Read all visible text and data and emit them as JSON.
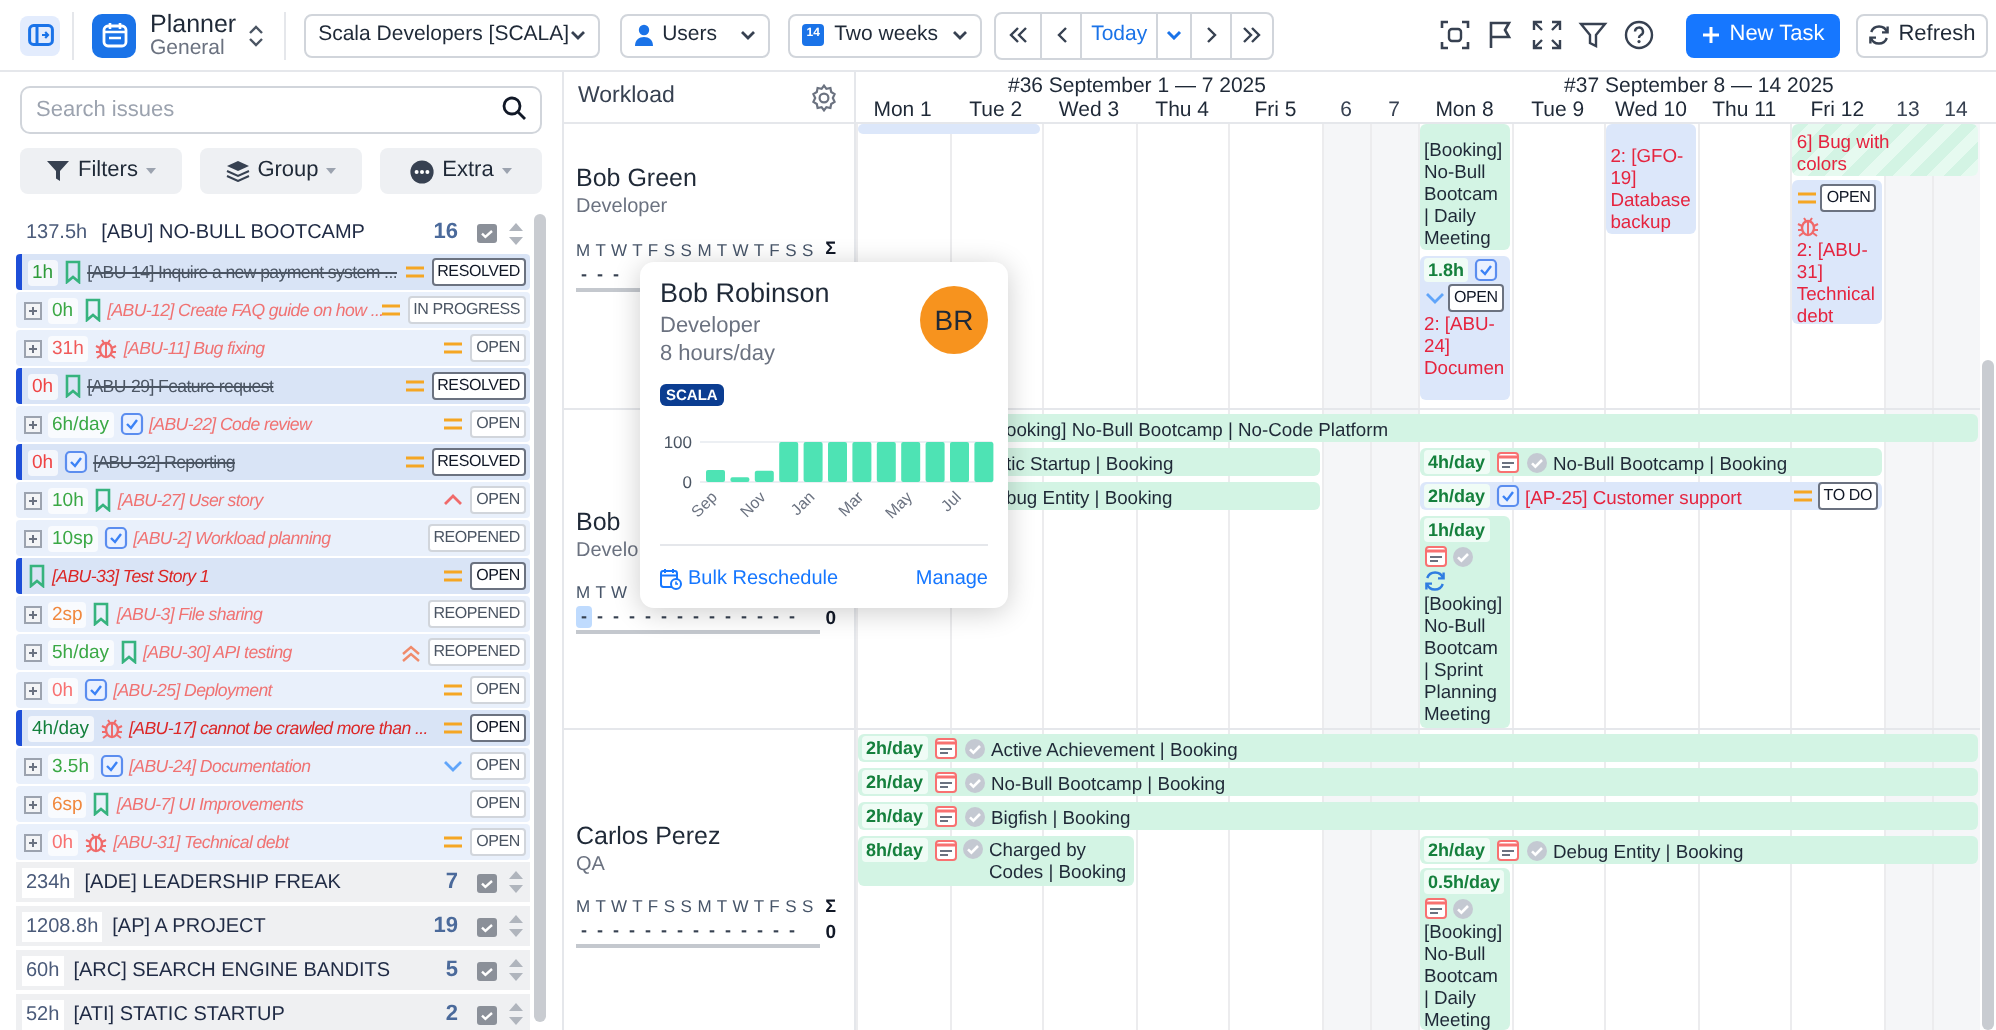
{
  "app": {
    "title": "Planner",
    "subtitle": "General"
  },
  "toolbar": {
    "team": "Scala Developers [SCALA]",
    "view": "Users",
    "range": "Two weeks",
    "range_icon": "14",
    "today": "Today",
    "new_task": "New Task",
    "refresh": "Refresh"
  },
  "search": {
    "placeholder": "Search issues"
  },
  "filters": [
    {
      "label": "Filters"
    },
    {
      "label": "Group"
    },
    {
      "label": "Extra"
    }
  ],
  "groups": [
    {
      "hours": "137.5h",
      "title": "[ABU] NO-BULL BOOTCAMP",
      "count": "16",
      "expanded": true,
      "issues": [
        {
          "highlighted": true,
          "estimate": "1h",
          "color": "#2e9b3a",
          "kind": "story",
          "title": "[ABU-14] Inquire a new payment system ...",
          "done": true,
          "priority": {
            "kind": "medium"
          },
          "status": "RESOLVED"
        },
        {
          "highlighted": false,
          "estimate": "0h",
          "color": "#3aa845",
          "kind": "story",
          "title": "[ABU-12] Create FAQ guide on how ...",
          "done": false,
          "priority": {
            "kind": "medium"
          },
          "status": "IN PROGRESS"
        },
        {
          "highlighted": false,
          "estimate": "31h",
          "color": "#f05a5a",
          "kind": "bug",
          "title": "[ABU-11] Bug fixing",
          "done": false,
          "priority": {
            "kind": "medium"
          },
          "status": "OPEN"
        },
        {
          "highlighted": true,
          "estimate": "0h",
          "color": "#ef4444",
          "kind": "story",
          "title": "[ABU-29] Feature request",
          "done": true,
          "priority": {
            "kind": "medium"
          },
          "status": "RESOLVED"
        },
        {
          "highlighted": false,
          "estimate": "6h/day",
          "color": "#3aa845",
          "kind": "task",
          "title": "[ABU-22] Code review",
          "done": false,
          "priority": {
            "kind": "medium"
          },
          "status": "OPEN"
        },
        {
          "highlighted": true,
          "estimate": "0h",
          "color": "#ef4444",
          "kind": "task",
          "title": "[ABU-32] Reporting",
          "done": true,
          "priority": {
            "kind": "medium"
          },
          "status": "RESOLVED"
        },
        {
          "highlighted": false,
          "estimate": "10h",
          "color": "#3aa845",
          "kind": "story",
          "title": "[ABU-27] User story",
          "done": false,
          "priority": {
            "kind": "high"
          },
          "status": "OPEN"
        },
        {
          "highlighted": false,
          "estimate": "10sp",
          "color": "#3aa845",
          "kind": "task",
          "title": "[ABU-2] Workload planning",
          "done": false,
          "status": "REOPENED"
        },
        {
          "highlighted": true,
          "kind": "story",
          "title": "[ABU-33] Test Story 1",
          "done": false,
          "priority": {
            "kind": "medium"
          },
          "status": "OPEN"
        },
        {
          "highlighted": false,
          "estimate": "2sp",
          "color": "#f0883e",
          "kind": "story",
          "title": "[ABU-3] File sharing",
          "done": false,
          "status": "REOPENED"
        },
        {
          "highlighted": false,
          "estimate": "5h/day",
          "color": "#3aa845",
          "kind": "story",
          "title": "[ABU-30] API testing",
          "done": false,
          "priority": {
            "kind": "highest"
          },
          "status": "REOPENED"
        },
        {
          "highlighted": false,
          "estimate": "0h",
          "color": "#f87171",
          "kind": "task",
          "title": "[ABU-25] Deployment",
          "done": false,
          "priority": {
            "kind": "medium"
          },
          "status": "OPEN"
        },
        {
          "highlighted": true,
          "estimate": "4h/day",
          "color": "#15803d",
          "kind": "bug",
          "title": "[ABU-17] cannot be crawled more than ...",
          "done": false,
          "priority": {
            "kind": "medium"
          },
          "status": "OPEN"
        },
        {
          "highlighted": false,
          "estimate": "3.5h",
          "color": "#3aa845",
          "kind": "task",
          "title": "[ABU-24] Documentation",
          "done": false,
          "priority": {
            "kind": "low"
          },
          "status": "OPEN"
        },
        {
          "highlighted": false,
          "estimate": "6sp",
          "color": "#f0883e",
          "kind": "story",
          "title": "[ABU-7] UI Improvements",
          "done": false,
          "status": "OPEN"
        },
        {
          "highlighted": false,
          "estimate": "0h",
          "color": "#f87171",
          "kind": "bug",
          "title": "[ABU-31] Technical debt",
          "done": false,
          "priority": {
            "kind": "medium"
          },
          "status": "OPEN"
        }
      ]
    },
    {
      "hours": "234h",
      "title": "[ADE] LEADERSHIP FREAK",
      "count": "7",
      "expanded": false
    },
    {
      "hours": "1208.8h",
      "title": "[AP] A PROJECT",
      "count": "19",
      "expanded": false
    },
    {
      "hours": "60h",
      "title": "[ARC] SEARCH ENGINE BANDITS",
      "count": "5",
      "expanded": false
    },
    {
      "hours": "52h",
      "title": "[ATI] STATIC STARTUP",
      "count": "2",
      "expanded": false
    }
  ],
  "workload": {
    "title": "Workload",
    "weeks": [
      {
        "label": "#36 September 1 — 7 2025",
        "days": [
          {
            "label": "Mon 1",
            "weekend": false
          },
          {
            "label": "Tue 2",
            "weekend": false
          },
          {
            "label": "Wed 3",
            "weekend": false
          },
          {
            "label": "Thu 4",
            "weekend": false
          },
          {
            "label": "Fri 5",
            "weekend": false
          },
          {
            "label": "6",
            "weekend": true
          },
          {
            "label": "7",
            "weekend": true
          }
        ]
      },
      {
        "label": "#37 September 8 — 14 2025",
        "days": [
          {
            "label": "Mon 8",
            "weekend": false
          },
          {
            "label": "Tue 9",
            "weekend": false
          },
          {
            "label": "Wed 10",
            "weekend": false
          },
          {
            "label": "Thu 11",
            "weekend": false
          },
          {
            "label": "Fri 12",
            "weekend": false
          },
          {
            "label": "13",
            "weekend": true
          },
          {
            "label": "14",
            "weekend": true
          }
        ]
      }
    ]
  },
  "users": [
    {
      "name": "Bob Green",
      "role": "Developer",
      "day_letters": "M T W T F S S M T W T F S S",
      "sum_label": "Σ",
      "daily": [
        "-",
        "-",
        "-"
      ],
      "today_highlighted": false,
      "events": [
        {
          "kind": "task",
          "clipped": true,
          "striped": false,
          "recurring": false
        },
        {
          "kind": "booking",
          "clipped": true,
          "striped": false,
          "recurring": false,
          "title": "[Booking] No-Bull Bootcam | Daily Meeting"
        },
        {
          "kind": "task",
          "clipped": false,
          "striped": false,
          "recurring": false,
          "rate": "1.8h",
          "priority": {
            "kind": "low"
          },
          "status": "OPEN",
          "title": "2: [ABU-24] Documen"
        },
        {
          "kind": "story",
          "clipped": true,
          "striped": false,
          "recurring": false,
          "title": "2: [GFO-19] Database backup"
        },
        {
          "kind": "bug",
          "clipped": true,
          "striped": true,
          "recurring": false,
          "title": "6] Bug with colors"
        },
        {
          "kind": "bug",
          "clipped": false,
          "striped": false,
          "recurring": false,
          "priority": {
            "kind": "medium"
          },
          "status": "OPEN",
          "title": "2: [ABU-31] Technical debt"
        }
      ]
    },
    {
      "name": "Bob",
      "role": "Develo",
      "day_letters": "M T W",
      "daily": [
        "-",
        "-",
        "-",
        "-",
        "-",
        "-",
        "-",
        "-",
        "-",
        "-",
        "-",
        "-",
        "-",
        "-"
      ],
      "today_highlighted": true,
      "total": "0",
      "events": [
        {
          "kind": "booking",
          "clipped": true,
          "striped": false,
          "recurring": false,
          "title": "ooking] No-Bull Bootcamp | No-Code Platform"
        },
        {
          "kind": "booking",
          "clipped": true,
          "striped": false,
          "recurring": false,
          "title": "tic Startup | Booking"
        },
        {
          "kind": "booking",
          "clipped": true,
          "striped": false,
          "recurring": false,
          "title": "bug Entity | Booking"
        },
        {
          "kind": "booking",
          "clipped": false,
          "striped": false,
          "recurring": false,
          "rate": "4h/day",
          "title": "No-Bull Bootcamp | Booking"
        },
        {
          "kind": "task",
          "clipped": false,
          "striped": false,
          "recurring": false,
          "rate": "2h/day",
          "priority": {
            "kind": "medium"
          },
          "status": "TO DO",
          "title": "[AP-25] Customer support"
        },
        {
          "kind": "booking",
          "clipped": false,
          "striped": false,
          "recurring": true,
          "rate": "1h/day",
          "title": "[Booking] No-Bull Bootcam | Sprint Planning Meeting"
        }
      ]
    },
    {
      "name": "Carlos Perez",
      "role": "QA",
      "day_letters": "M T W T F S S M T W T F S S",
      "sum_label": "Σ",
      "daily": [
        "-",
        "-",
        "-",
        "-",
        "-",
        "-",
        "-",
        "-",
        "-",
        "-",
        "-",
        "-",
        "-",
        "-"
      ],
      "today_highlighted": false,
      "total": "0",
      "events": [
        {
          "kind": "booking",
          "clipped": false,
          "striped": false,
          "recurring": false,
          "rate": "2h/day",
          "title": "Active Achievement | Booking"
        },
        {
          "kind": "booking",
          "clipped": false,
          "striped": false,
          "recurring": false,
          "rate": "2h/day",
          "title": "No-Bull Bootcamp | Booking"
        },
        {
          "kind": "booking",
          "clipped": false,
          "striped": false,
          "recurring": false,
          "rate": "2h/day",
          "title": "Bigfish | Booking"
        },
        {
          "kind": "booking",
          "clipped": false,
          "striped": false,
          "recurring": false,
          "rate": "8h/day",
          "title": "Charged by Codes | Booking"
        },
        {
          "kind": "booking",
          "clipped": false,
          "striped": false,
          "recurring": false,
          "rate": "2h/day",
          "title": "Debug Entity | Booking"
        },
        {
          "kind": "booking",
          "clipped": false,
          "striped": false,
          "recurring": false,
          "rate": "0.5h/day",
          "title": "[Booking] No-Bull Bootcam | Daily Meeting"
        }
      ]
    }
  ],
  "popup": {
    "name": "Bob Robinson",
    "role": "Developer",
    "capacity": "8 hours/day",
    "team": "SCALA",
    "initials": "BR",
    "chart_data": {
      "type": "bar",
      "categories": [
        "Sep",
        null,
        "Nov",
        null,
        "Jan",
        null,
        "Mar",
        null,
        "May",
        null,
        "Jul",
        null
      ],
      "yticks": [
        0,
        100
      ],
      "ylim": [
        0,
        100
      ],
      "values": [
        30,
        12,
        28,
        100,
        100,
        100,
        100,
        100,
        100,
        100,
        100,
        100
      ]
    },
    "actions": [
      "Bulk Reschedule",
      "Manage"
    ]
  }
}
